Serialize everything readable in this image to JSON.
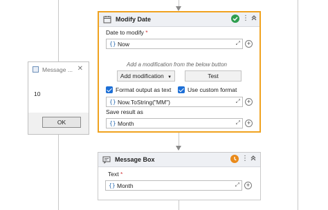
{
  "modify_date": {
    "title": "Modify Date",
    "date_label": "Date to modify",
    "required_mark": "*",
    "date_value": "Now",
    "hint": "Add a modification from the below button",
    "add_modification_label": "Add modification",
    "test_label": "Test",
    "format_output_label": "Format output as text",
    "use_custom_format_label": "Use custom format",
    "format_expression": "Now.ToString(\"MM\")",
    "save_result_label": "Save result as",
    "save_result_value": "Month",
    "status": "success"
  },
  "message_box": {
    "title": "Message Box",
    "text_label": "Text",
    "required_mark": "*",
    "text_value": "Month",
    "status": "pending"
  },
  "dialog": {
    "title": "Message ...",
    "body": "10",
    "ok_label": "OK"
  },
  "icons": {
    "brace": "{}",
    "expand": "⤢",
    "plus": "+",
    "kebab": "⋮",
    "collapse": "⌃",
    "close": "✕",
    "dropdown": "▼"
  },
  "colors": {
    "selected_border": "#f0a21e",
    "success": "#2e9e4f",
    "pending": "#e98a1a",
    "checkbox": "#1d6fd6"
  }
}
